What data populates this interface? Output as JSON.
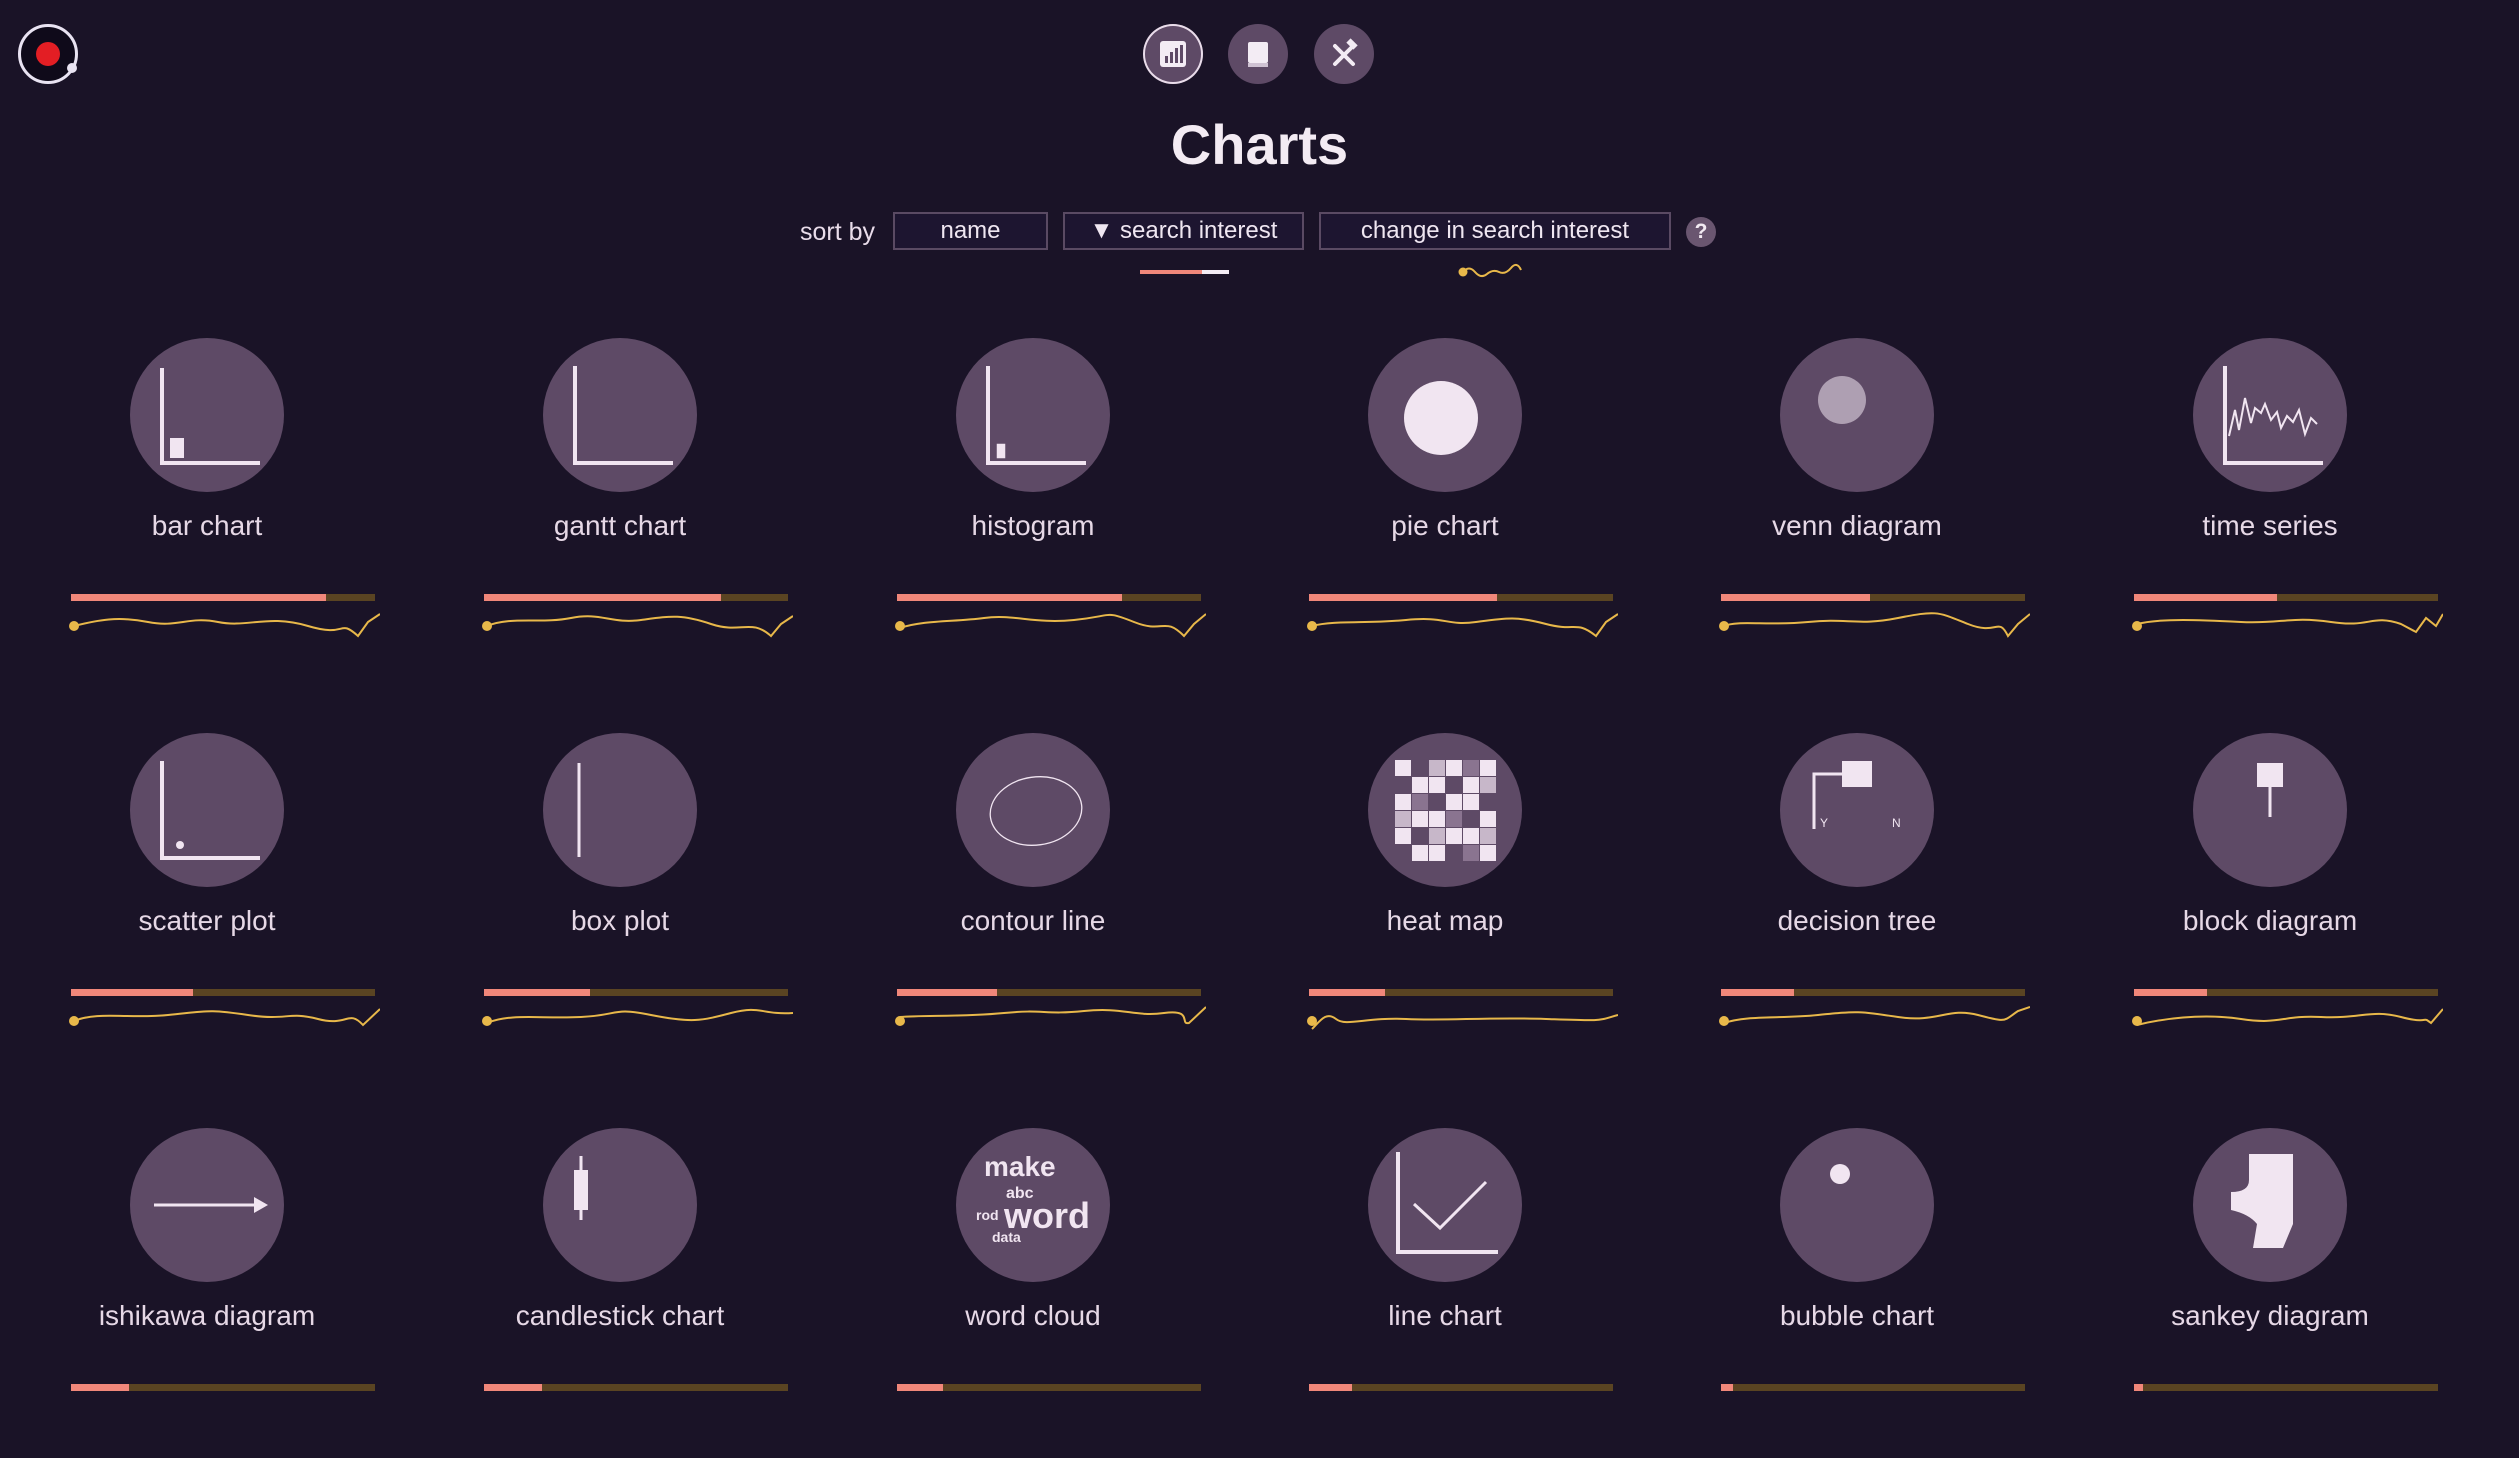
{
  "title": "Charts",
  "nav": [
    {
      "icon": "bar-chart-icon",
      "active": true
    },
    {
      "icon": "book-icon",
      "active": false
    },
    {
      "icon": "tools-icon",
      "active": false
    }
  ],
  "colors": {
    "background": "#1a1327",
    "circle": "#5e4a66",
    "bar_fill": "#f0877a",
    "bar_track": "#5a4422",
    "sparkline": "#e8b84a",
    "logo_dot": "#e31e24"
  },
  "sort": {
    "label": "sort by",
    "options": [
      "name",
      "▼ search interest",
      "change in search interest"
    ],
    "help": "?"
  },
  "charts": [
    {
      "name": "bar chart",
      "icon": "bar-chart-icon",
      "interest": 0.84
    },
    {
      "name": "gantt chart",
      "icon": "gantt-chart-icon",
      "interest": 0.78
    },
    {
      "name": "histogram",
      "icon": "histogram-icon",
      "interest": 0.74
    },
    {
      "name": "pie chart",
      "icon": "pie-chart-icon",
      "interest": 0.62
    },
    {
      "name": "venn diagram",
      "icon": "venn-diagram-icon",
      "interest": 0.49
    },
    {
      "name": "time series",
      "icon": "time-series-icon",
      "interest": 0.47
    },
    {
      "name": "scatter plot",
      "icon": "scatter-plot-icon",
      "interest": 0.4
    },
    {
      "name": "box plot",
      "icon": "box-plot-icon",
      "interest": 0.35
    },
    {
      "name": "contour line",
      "icon": "contour-line-icon",
      "interest": 0.33
    },
    {
      "name": "heat map",
      "icon": "heat-map-icon",
      "interest": 0.25
    },
    {
      "name": "decision tree",
      "icon": "decision-tree-icon",
      "interest": 0.24
    },
    {
      "name": "block diagram",
      "icon": "block-diagram-icon",
      "interest": 0.24
    },
    {
      "name": "ishikawa diagram",
      "icon": "ishikawa-diagram-icon",
      "interest": 0.19
    },
    {
      "name": "candlestick chart",
      "icon": "candlestick-chart-icon",
      "interest": 0.19
    },
    {
      "name": "word cloud",
      "icon": "word-cloud-icon",
      "interest": 0.15
    },
    {
      "name": "line chart",
      "icon": "line-chart-icon",
      "interest": 0.14
    },
    {
      "name": "bubble chart",
      "icon": "bubble-chart-icon",
      "interest": 0.04
    },
    {
      "name": "sankey diagram",
      "icon": "sankey-diagram-icon",
      "interest": 0.03
    }
  ],
  "word_cloud_words": [
    "make",
    "abc",
    "rod",
    "word",
    "data"
  ]
}
